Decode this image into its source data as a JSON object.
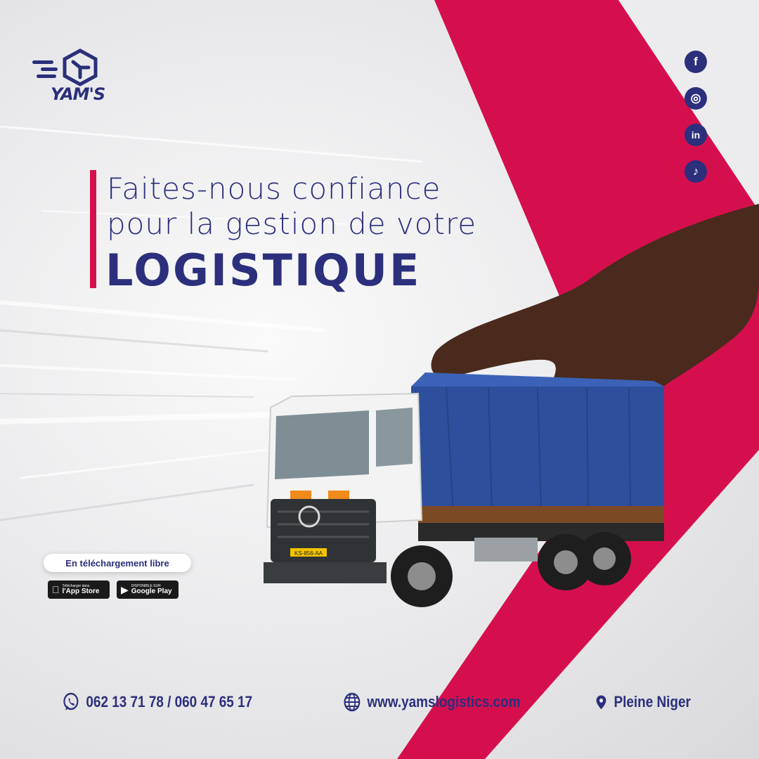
{
  "brand": {
    "name": "YAM'S"
  },
  "colors": {
    "accent": "#d50f4e",
    "navy": "#2b2f7c",
    "background": "#ececee"
  },
  "social": [
    {
      "name": "facebook",
      "glyph": "f"
    },
    {
      "name": "instagram",
      "glyph": "◎"
    },
    {
      "name": "linkedin",
      "glyph": "in"
    },
    {
      "name": "tiktok",
      "glyph": "♪"
    }
  ],
  "headline": {
    "line1": "Faites-nous confiance",
    "line2": "pour la gestion de votre",
    "line3": "LOGISTIQUE"
  },
  "truck": {
    "plate": "KS-856-AA"
  },
  "download": {
    "label": "En téléchargement libre",
    "app_store": {
      "small": "Télécharger dans",
      "big": "l'App Store"
    },
    "google_play": {
      "small": "DISPONIBLE SUR",
      "big": "Google Play"
    }
  },
  "footer": {
    "phone": "062 13 71 78 / 060 47 65 17",
    "website": "www.yamslogistics.com",
    "location": "Pleine Niger"
  }
}
